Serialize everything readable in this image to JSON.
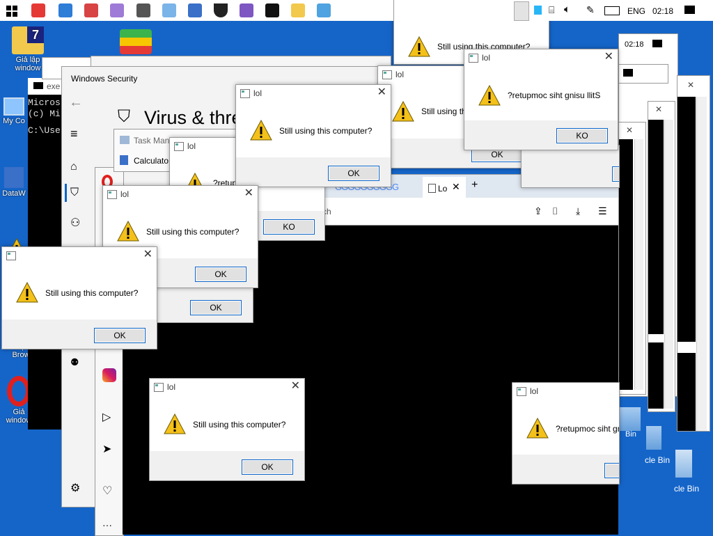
{
  "taskbar": {
    "language": "ENG",
    "clock": "02:18"
  },
  "desktop": {
    "icons": [
      {
        "label": "Giả lập window"
      },
      {
        "label": "My Co"
      },
      {
        "label": "DataW"
      },
      {
        "label": "Op Brow"
      },
      {
        "label": "Giả window"
      }
    ],
    "recycle_bin": [
      "Bin",
      "cle Bin",
      "cle Bin"
    ]
  },
  "console": {
    "tab": "exe",
    "lines": [
      "Micros",
      "(c) Mi",
      "C:\\Use"
    ]
  },
  "windows_security": {
    "title": "Windows Security",
    "heading": "Virus & thre"
  },
  "task_manager": {
    "items": [
      "Task Man",
      "Calculato"
    ]
  },
  "browser": {
    "tab": "Lo",
    "search_hint": "ch"
  },
  "second_clock": "02:18",
  "dialogs": [
    {
      "title": "lol",
      "message": "Still using this computer?",
      "button": "OK"
    },
    {
      "title": "lol",
      "message": "Still using this computer?",
      "button": "OK"
    },
    {
      "title": "lol",
      "message": "?retupmoc siht gnisu llitS",
      "button": "KO"
    },
    {
      "title": "lol",
      "message": "Still using th",
      "button": "OK"
    },
    {
      "title": "lol",
      "message": "Still using this computer?",
      "button": "OK"
    },
    {
      "title": "lol",
      "message": "?retup",
      "button": "KO"
    },
    {
      "title": "lol",
      "message": "Still using this computer?",
      "button": "OK"
    },
    {
      "title": "lol",
      "message": "Still using this computer?",
      "button": "OK"
    },
    {
      "title": "lol",
      "message": "Still using this computer?",
      "button": "OK"
    },
    {
      "title": "lol",
      "message": "?retupmoc siht gn",
      "button": "KO"
    }
  ],
  "bottom_ok": "OK"
}
